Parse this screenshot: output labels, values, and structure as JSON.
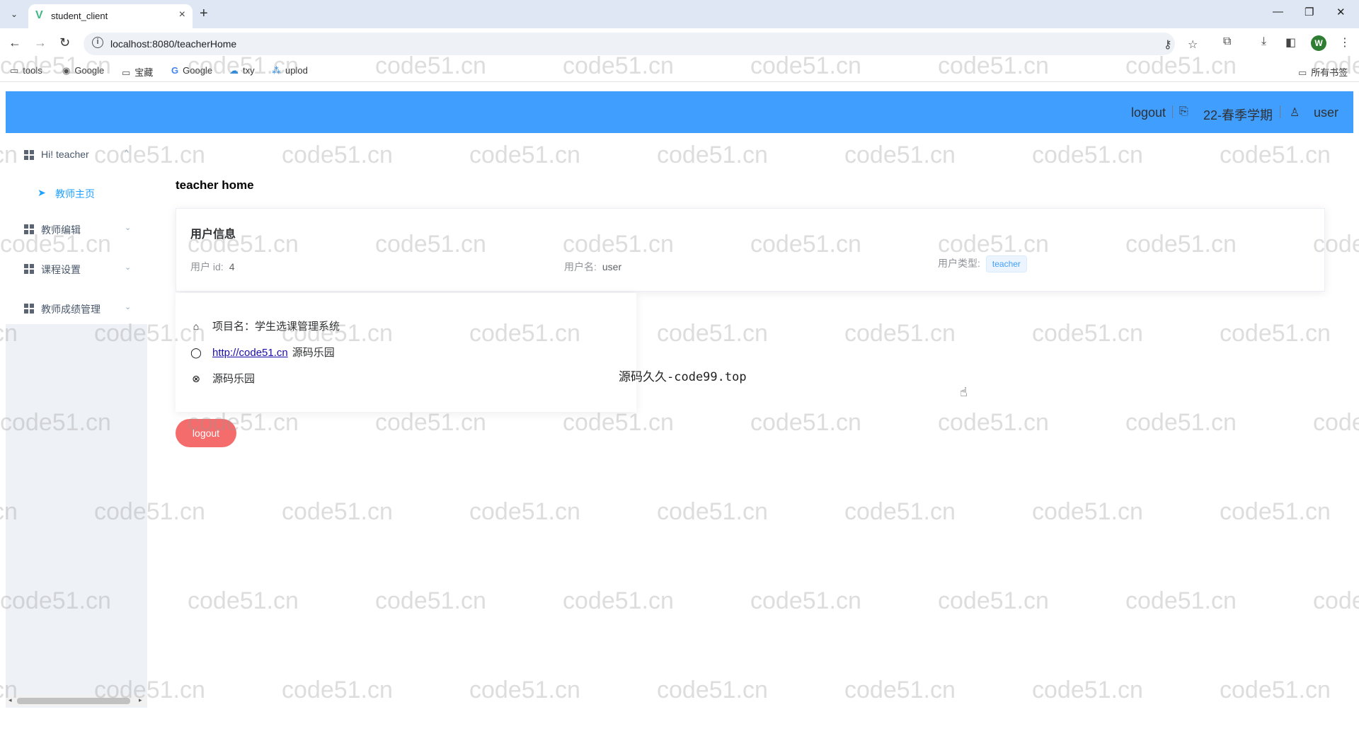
{
  "browser": {
    "tab_title": "student_client",
    "tab_close": "×",
    "new_tab": "+",
    "url": "localhost:8080/teacherHome",
    "bookmarks": [
      {
        "label": "tools",
        "icon": "folder-icon"
      },
      {
        "label": "Google",
        "icon": "chrome-icon"
      },
      {
        "label": "宝藏",
        "icon": "folder-icon"
      },
      {
        "label": "Google",
        "icon": "google-icon"
      },
      {
        "label": "txy",
        "icon": "cloud-icon"
      },
      {
        "label": "uplod",
        "icon": "apps-icon"
      }
    ],
    "all_bookmarks": "所有书签",
    "profile_initial": "W"
  },
  "header": {
    "logout": "logout",
    "semester": "22-春季学期",
    "user": "user",
    "color": "#409eff"
  },
  "sidebar": {
    "items": [
      {
        "label": "Hi! teacher",
        "chevron": "^"
      },
      {
        "label": "教师编辑",
        "chevron": "⌄"
      },
      {
        "label": "课程设置",
        "chevron": "⌄"
      },
      {
        "label": "教师成绩管理",
        "chevron": "⌄"
      }
    ],
    "sub_item": "教师主页"
  },
  "main": {
    "page_title": "teacher home",
    "user_card": {
      "title": "用户信息",
      "id_label": "用户 id:",
      "id_value": "4",
      "name_label": "用户名:",
      "name_value": "user",
      "type_label": "用户类型:",
      "type_value": "teacher"
    },
    "info_card": {
      "project": "项目名：学生选课管理系统",
      "link": "http://code51.cn",
      "link_suffix": "源码乐园",
      "site": "源码乐园"
    },
    "logout_button": "logout",
    "note": "源码久久-code99.top"
  },
  "watermark": "code51.cn"
}
